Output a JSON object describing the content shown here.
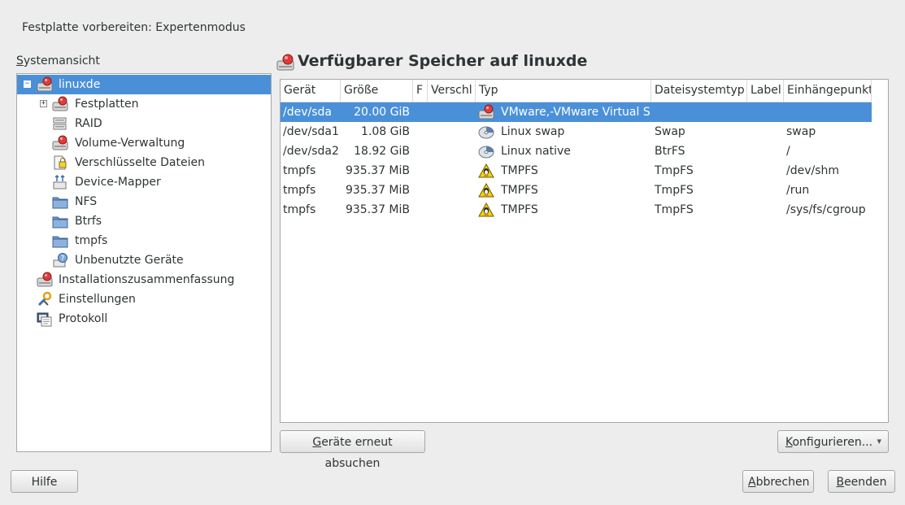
{
  "window": {
    "title": "Festplatte vorbereiten: Expertenmodus"
  },
  "sidebar": {
    "label_mnemonic": "S",
    "label_rest": "ystemansicht",
    "tree": [
      {
        "label": "linuxde",
        "icon": "harddisk-icon",
        "expander": "−",
        "selected": true
      },
      {
        "label": "Festplatten",
        "icon": "harddisk-icon",
        "expander": "+"
      },
      {
        "label": "RAID",
        "icon": "raid-icon"
      },
      {
        "label": "Volume-Verwaltung",
        "icon": "harddisk-icon"
      },
      {
        "label": "Verschlüsselte Dateien",
        "icon": "encrypted-file-icon"
      },
      {
        "label": "Device-Mapper",
        "icon": "device-mapper-icon"
      },
      {
        "label": "NFS",
        "icon": "folder-icon"
      },
      {
        "label": "Btrfs",
        "icon": "folder-icon"
      },
      {
        "label": "tmpfs",
        "icon": "folder-icon"
      },
      {
        "label": "Unbenutzte Geräte",
        "icon": "question-device-icon"
      },
      {
        "label": "Installationszusammenfassung",
        "icon": "harddisk-icon"
      },
      {
        "label": "Einstellungen",
        "icon": "tools-icon"
      },
      {
        "label": "Protokoll",
        "icon": "log-icon"
      }
    ]
  },
  "main": {
    "title": "Verfügbarer Speicher auf linuxde",
    "columns": [
      "Gerät",
      "Größe",
      "F",
      "Verschl",
      "Typ",
      "Dateisystemtyp",
      "Label",
      "Einhängepunkt"
    ],
    "rows": [
      {
        "device": "/dev/sda",
        "size": "20.00 GiB",
        "type": "VMware,-VMware Virtual S",
        "type_icon": "harddisk-icon",
        "fstype": "",
        "label": "",
        "mount": "",
        "selected": true
      },
      {
        "device": "/dev/sda1",
        "size": "1.08 GiB",
        "type": "Linux swap",
        "type_icon": "partition-icon",
        "fstype": "Swap",
        "label": "",
        "mount": "swap"
      },
      {
        "device": "/dev/sda2",
        "size": "18.92 GiB",
        "type": "Linux native",
        "type_icon": "partition-icon",
        "fstype": "BtrFS",
        "label": "",
        "mount": "/"
      },
      {
        "device": "tmpfs",
        "size": "935.37 MiB",
        "type": "TMPFS",
        "type_icon": "tux-icon",
        "fstype": "TmpFS",
        "label": "",
        "mount": "/dev/shm"
      },
      {
        "device": "tmpfs",
        "size": "935.37 MiB",
        "type": "TMPFS",
        "type_icon": "tux-icon",
        "fstype": "TmpFS",
        "label": "",
        "mount": "/run"
      },
      {
        "device": "tmpfs",
        "size": "935.37 MiB",
        "type": "TMPFS",
        "type_icon": "tux-icon",
        "fstype": "TmpFS",
        "label": "",
        "mount": "/sys/fs/cgroup"
      }
    ]
  },
  "buttons": {
    "rescan": {
      "mn": "G",
      "rest": "eräte erneut absuchen"
    },
    "configure": {
      "mn": "K",
      "rest": "onfigurieren...",
      "arrow": "▾"
    },
    "help": "Hilfe",
    "cancel": {
      "mn": "A",
      "rest": "bbrechen"
    },
    "finish": {
      "mn": "B",
      "rest": "eenden"
    }
  },
  "colors": {
    "selection": "#4a90d9",
    "background": "#ededed"
  }
}
